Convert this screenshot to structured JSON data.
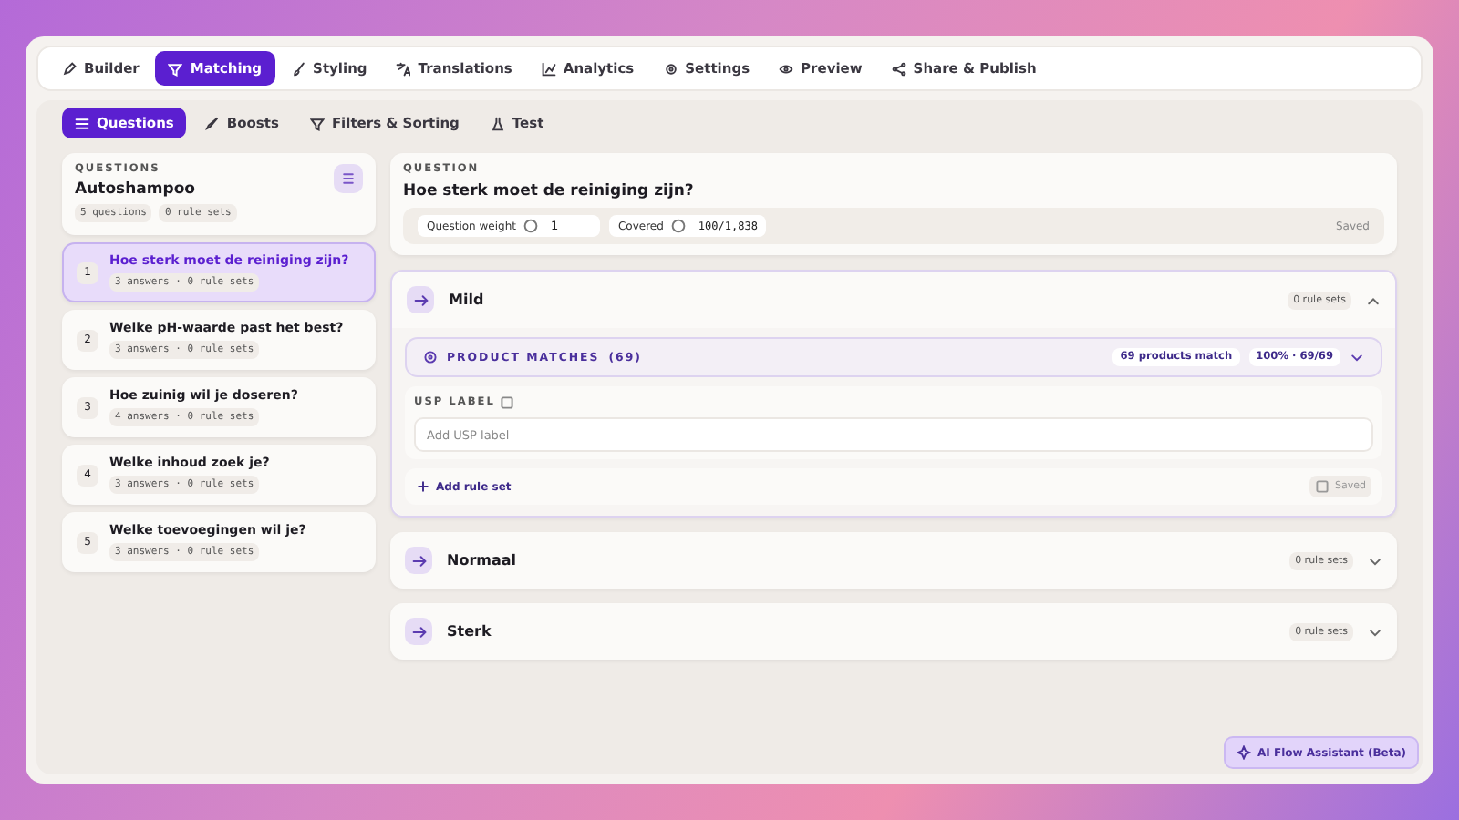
{
  "nav_tabs": [
    {
      "label": "Builder",
      "selected": false
    },
    {
      "label": "Matching",
      "selected": true
    },
    {
      "label": "Styling",
      "selected": false
    },
    {
      "label": "Translations",
      "selected": false
    },
    {
      "label": "Analytics",
      "selected": false
    },
    {
      "label": "Settings",
      "selected": false
    },
    {
      "label": "Preview",
      "selected": false
    },
    {
      "label": "Share & Publish",
      "selected": false
    }
  ],
  "sub_tabs": [
    {
      "label": "Questions",
      "selected": true
    },
    {
      "label": "Boosts",
      "selected": false
    },
    {
      "label": "Filters & Sorting",
      "selected": false
    },
    {
      "label": "Test",
      "selected": false
    }
  ],
  "sidebar": {
    "eyebrow": "QUESTIONS",
    "title": "Autoshampoo",
    "stats": [
      "5 questions",
      "0 rule sets"
    ],
    "items": [
      {
        "number": "1",
        "title": "Hoe sterk moet de reiniging zijn?",
        "meta": "3 answers · 0 rule sets",
        "selected": true
      },
      {
        "number": "2",
        "title": "Welke pH-waarde past het best?",
        "meta": "3 answers · 0 rule sets",
        "selected": false
      },
      {
        "number": "3",
        "title": "Hoe zuinig wil je doseren?",
        "meta": "4 answers · 0 rule sets",
        "selected": false
      },
      {
        "number": "4",
        "title": "Welke inhoud zoek je?",
        "meta": "3 answers · 0 rule sets",
        "selected": false
      },
      {
        "number": "5",
        "title": "Welke toevoegingen wil je?",
        "meta": "3 answers · 0 rule sets",
        "selected": false
      }
    ]
  },
  "question": {
    "eyebrow": "QUESTION",
    "title": "Hoe sterk moet de reiniging zijn?",
    "weight_label": "Question weight",
    "weight_value": "1",
    "covered_label": "Covered",
    "covered_value": "100/1,838",
    "status": "Saved"
  },
  "answers": [
    {
      "title": "Mild",
      "rule_sets": "0 rule sets",
      "expanded": true,
      "product_matches": {
        "label": "PRODUCT MATCHES",
        "count": "(69)",
        "match_badge": "69 products match",
        "percent_badge": "100% · 69/69"
      },
      "usp_label": "USP LABEL",
      "usp_placeholder": "Add USP label",
      "add_rule_set": "Add rule set",
      "status": "Saved"
    },
    {
      "title": "Normaal",
      "rule_sets": "0 rule sets",
      "expanded": false
    },
    {
      "title": "Sterk",
      "rule_sets": "0 rule sets",
      "expanded": false
    }
  ],
  "assistant_button": "AI Flow Assistant (Beta)"
}
